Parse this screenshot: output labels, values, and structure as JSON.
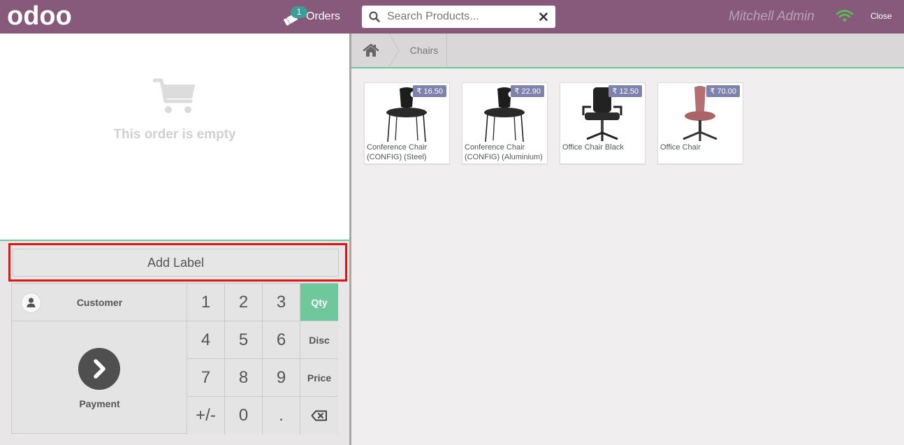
{
  "header": {
    "logo_text": "odoo",
    "orders_label": "Orders",
    "orders_count": "1",
    "search_placeholder": "Search Products...",
    "user_name": "Mitchell Admin",
    "close_label": "Close"
  },
  "order": {
    "empty_text": "This order is empty",
    "add_label": "Add Label"
  },
  "actionpad": {
    "customer_label": "Customer",
    "payment_label": "Payment"
  },
  "numpad": {
    "keys": [
      "1",
      "2",
      "3",
      "Qty",
      "4",
      "5",
      "6",
      "Disc",
      "7",
      "8",
      "9",
      "Price",
      "+/-",
      "0",
      ".",
      "⌫"
    ],
    "active_mode": "Qty"
  },
  "breadcrumb": {
    "items": [
      "Chairs"
    ]
  },
  "products": [
    {
      "name": "Conference Chair (CONFIG) (Steel)",
      "price": "₹ 16.50",
      "color": "#1c1c1c"
    },
    {
      "name": "Conference Chair (CONFIG) (Aluminium)",
      "price": "₹ 22.90",
      "color": "#1c1c1c"
    },
    {
      "name": "Office Chair Black",
      "price": "₹ 12.50",
      "color": "#222222"
    },
    {
      "name": "Office Chair",
      "price": "₹ 70.00",
      "color": "#b56f70"
    }
  ],
  "colors": {
    "header_bg": "#875a7b",
    "accent_green": "#6ec89b",
    "badge_teal": "#3c9c98",
    "price_tag": "#7f82ac",
    "highlight_red": "#e01414"
  }
}
